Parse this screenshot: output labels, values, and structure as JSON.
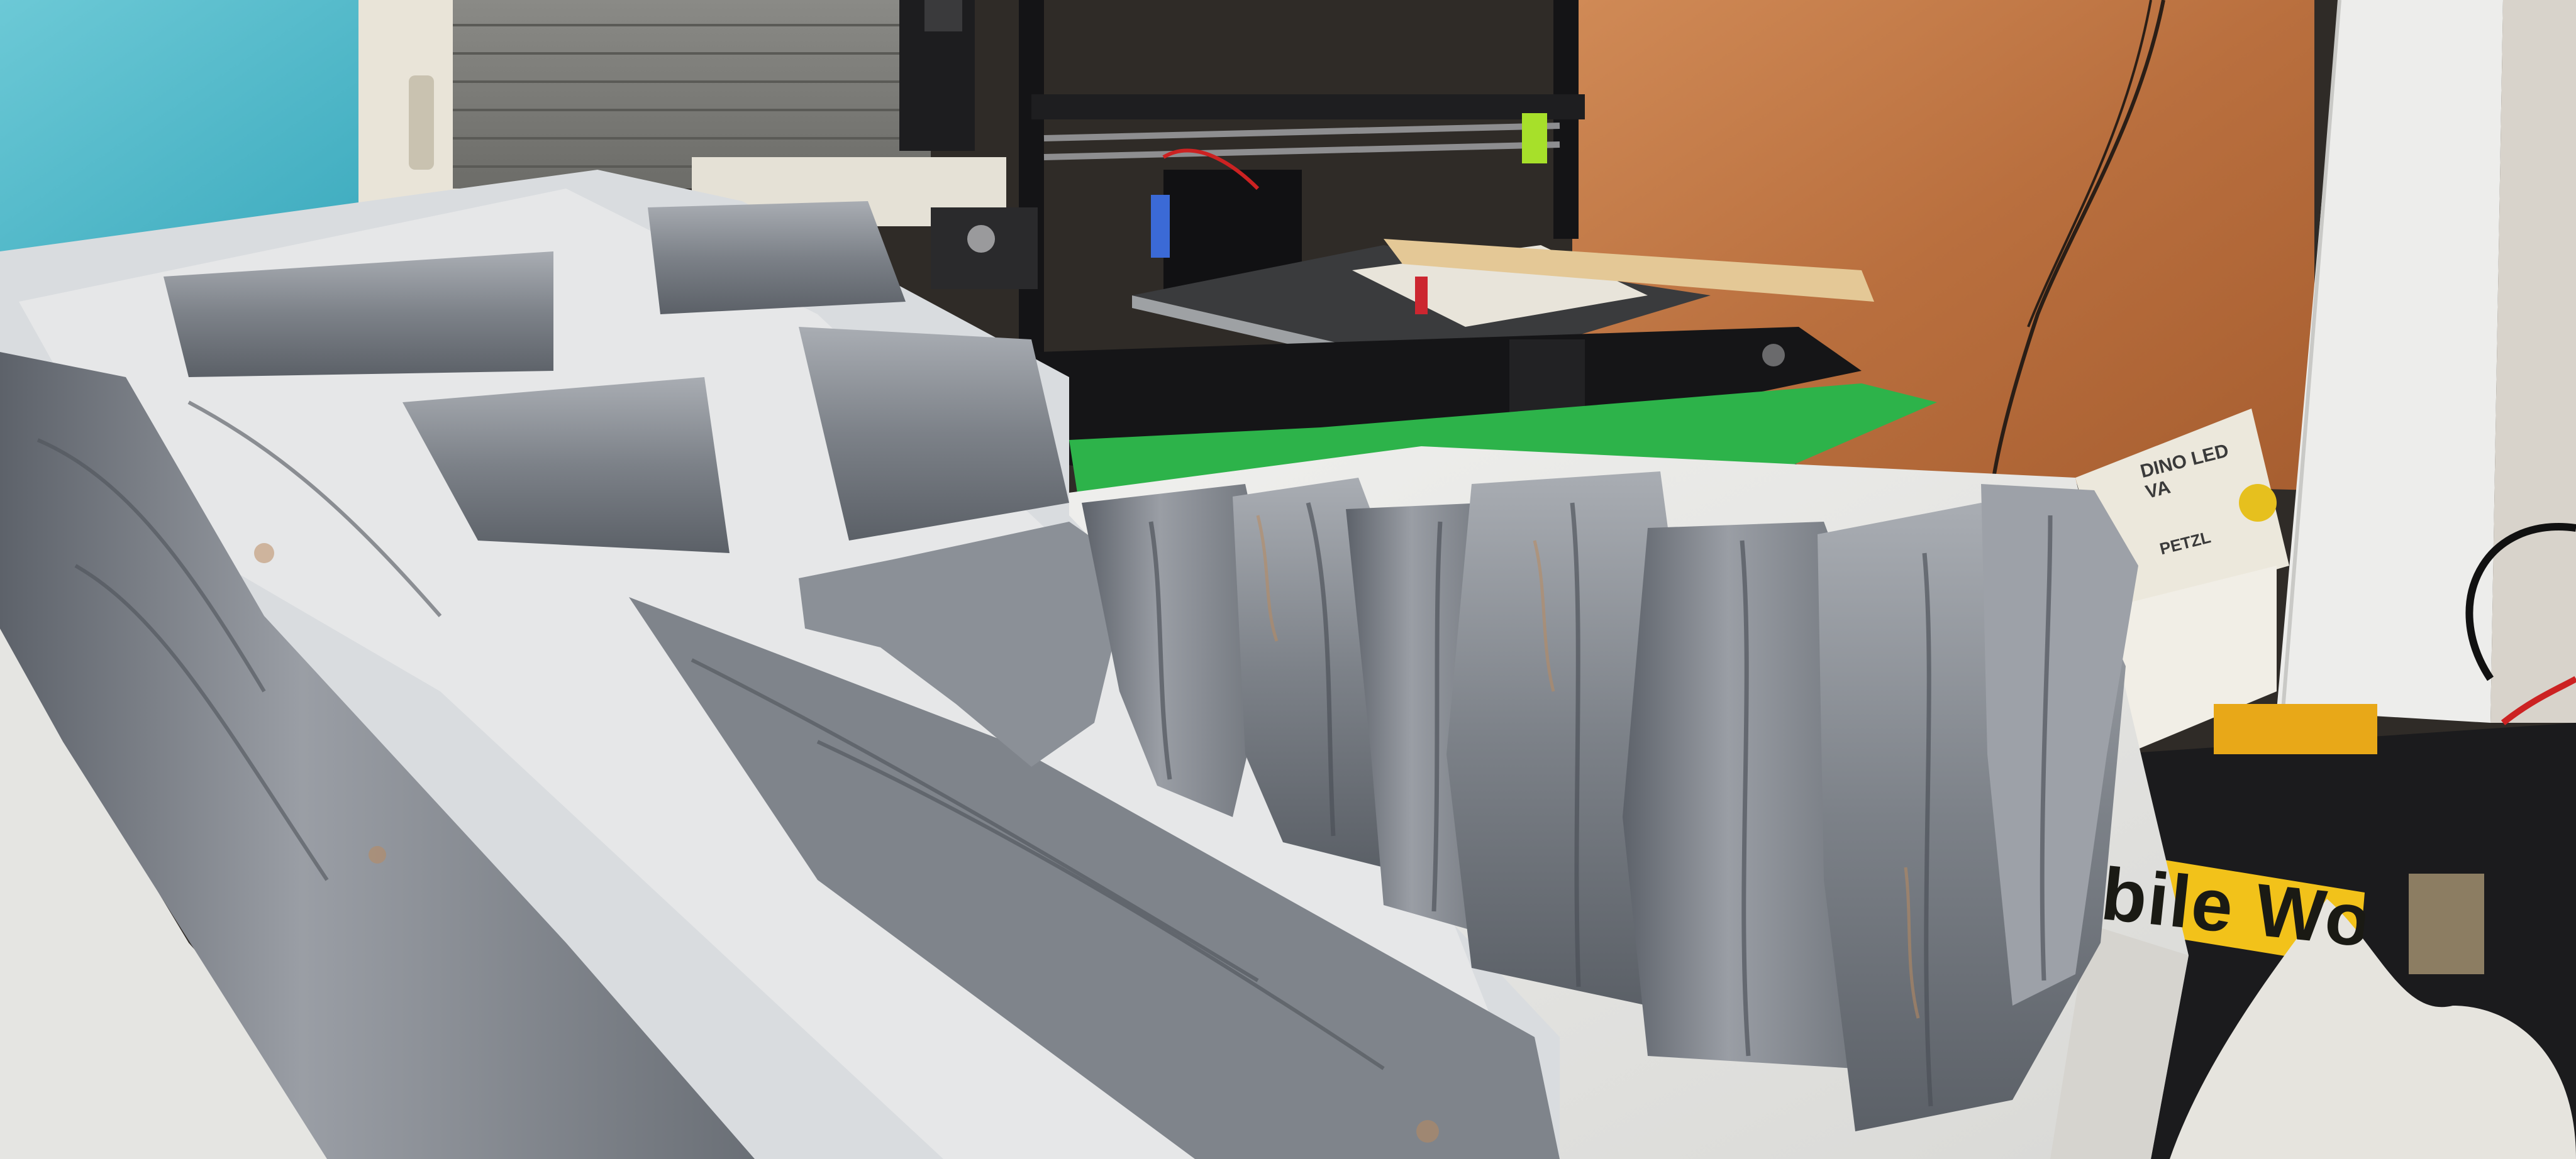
{
  "scene": {
    "toolbox_label": "bile Work Ce",
    "device_label_top": "DINO LED VA",
    "device_label_bottom": "PETZL"
  },
  "colors": {
    "teal_wall": "#5fbfcf",
    "wood_panel": "#c07a4a",
    "styrofoam": "#e8e8e6",
    "rock_grey": "#7d8289",
    "rock_dark": "#4e535a",
    "printer_black": "#1c1c1e",
    "green_mat": "#2db34a",
    "toolbox_yellow": "#f2c21a"
  }
}
